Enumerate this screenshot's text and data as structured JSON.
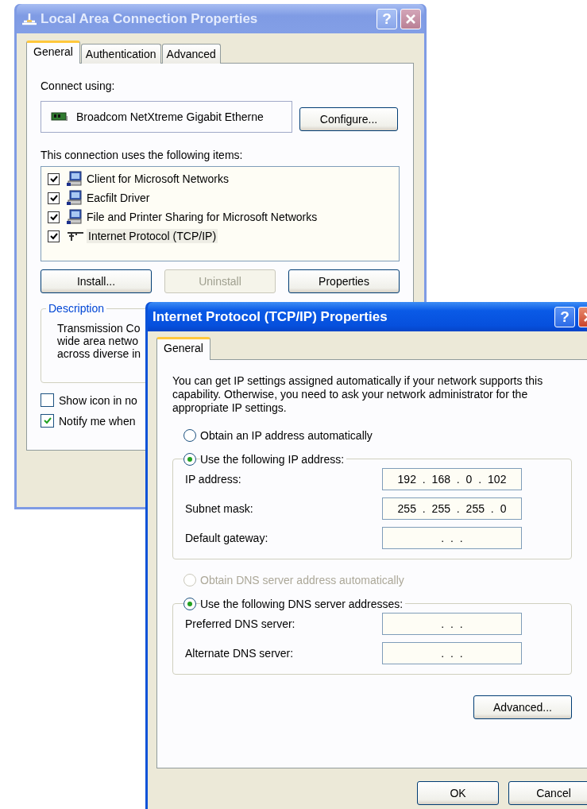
{
  "connection_window": {
    "title": "Local Area Connection Properties",
    "help_button": "?",
    "tabs": [
      {
        "label": "General",
        "selected": true
      },
      {
        "label": "Authentication",
        "selected": false
      },
      {
        "label": "Advanced",
        "selected": false
      }
    ],
    "connect_using_label": "Connect using:",
    "adapter": "Broadcom NetXtreme Gigabit Etherne",
    "configure_button": "Configure...",
    "items_label": "This connection uses the following items:",
    "items": [
      {
        "label": "Client for Microsoft Networks",
        "checked": true,
        "selected": false,
        "kind": "computer"
      },
      {
        "label": "Eacfilt Driver",
        "checked": true,
        "selected": false,
        "kind": "computer"
      },
      {
        "label": "File and Printer Sharing for Microsoft Networks",
        "checked": true,
        "selected": false,
        "kind": "computer"
      },
      {
        "label": "Internet Protocol (TCP/IP)",
        "checked": true,
        "selected": true,
        "kind": "protocol"
      }
    ],
    "buttons": [
      {
        "label": "Install...",
        "disabled": false
      },
      {
        "label": "Uninstall",
        "disabled": true
      },
      {
        "label": "Properties",
        "disabled": false
      }
    ],
    "description": {
      "title": "Description",
      "lines": [
        "Transmission Co",
        "wide area netwo",
        "across diverse in"
      ]
    },
    "options": [
      {
        "label": "Show icon in no",
        "checked": false
      },
      {
        "label": "Notify me when",
        "checked": true
      }
    ]
  },
  "tcpip_window": {
    "title": "Internet Protocol (TCP/IP) Properties",
    "help_button": "?",
    "tabs": [
      {
        "label": "General",
        "selected": true
      }
    ],
    "intro": "You can get IP settings assigned automatically if your network supports this capability. Otherwise, you need to ask your network administrator for the appropriate IP settings.",
    "ip_choices": [
      {
        "label": "Obtain an IP address automatically",
        "selected": false,
        "disabled": false
      },
      {
        "label": "Use the following IP address:",
        "selected": true,
        "disabled": false
      }
    ],
    "ip_fields": [
      {
        "label": "IP address:",
        "value": "192 . 168 . 0 . 102"
      },
      {
        "label": "Subnet mask:",
        "value": "255 . 255 . 255 . 0"
      },
      {
        "label": "Default gateway:",
        "value": ". . ."
      }
    ],
    "dns_choices": [
      {
        "label": "Obtain DNS server address automatically",
        "selected": false,
        "disabled": true
      },
      {
        "label": "Use the following DNS server addresses:",
        "selected": true,
        "disabled": false
      }
    ],
    "dns_fields": [
      {
        "label": "Preferred DNS server:",
        "value": ". . ."
      },
      {
        "label": "Alternate DNS server:",
        "value": ". . ."
      }
    ],
    "advanced_button": "Advanced...",
    "ok_button": "OK",
    "cancel_button": "Cancel"
  }
}
